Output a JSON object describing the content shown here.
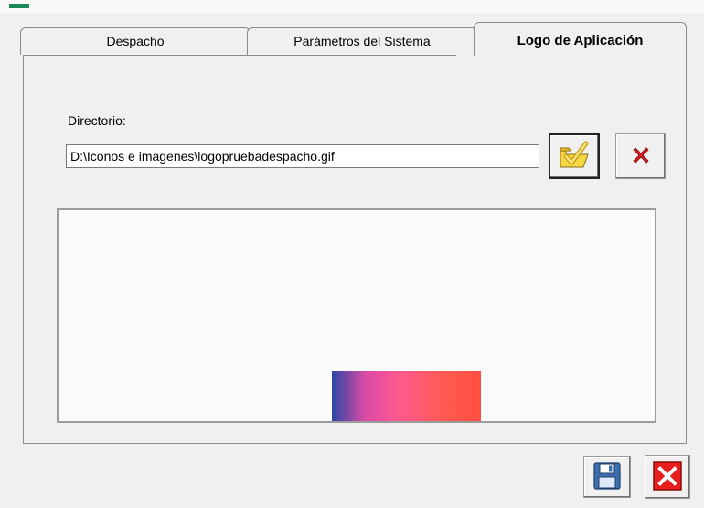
{
  "tabs": [
    {
      "label": "Despacho",
      "active": false
    },
    {
      "label": "Parámetros del Sistema",
      "active": false
    },
    {
      "label": "Logo de Aplicación",
      "active": true
    }
  ],
  "directory": {
    "label": "Directorio:",
    "value": "D:\\Iconos e imagenes\\logopruebadespacho.gif"
  },
  "buttons": {
    "browse_icon": "folder-check-icon",
    "clear_icon": "red-x-icon",
    "save_icon": "floppy-disk-icon",
    "close_icon": "close-x-icon"
  },
  "colors": {
    "accent_green": "#1c8a58",
    "clear_red": "#d81c1c",
    "close_red": "#e81e1e",
    "folder_yellow": "#f6d743",
    "save_blue": "#3d6fb0"
  }
}
